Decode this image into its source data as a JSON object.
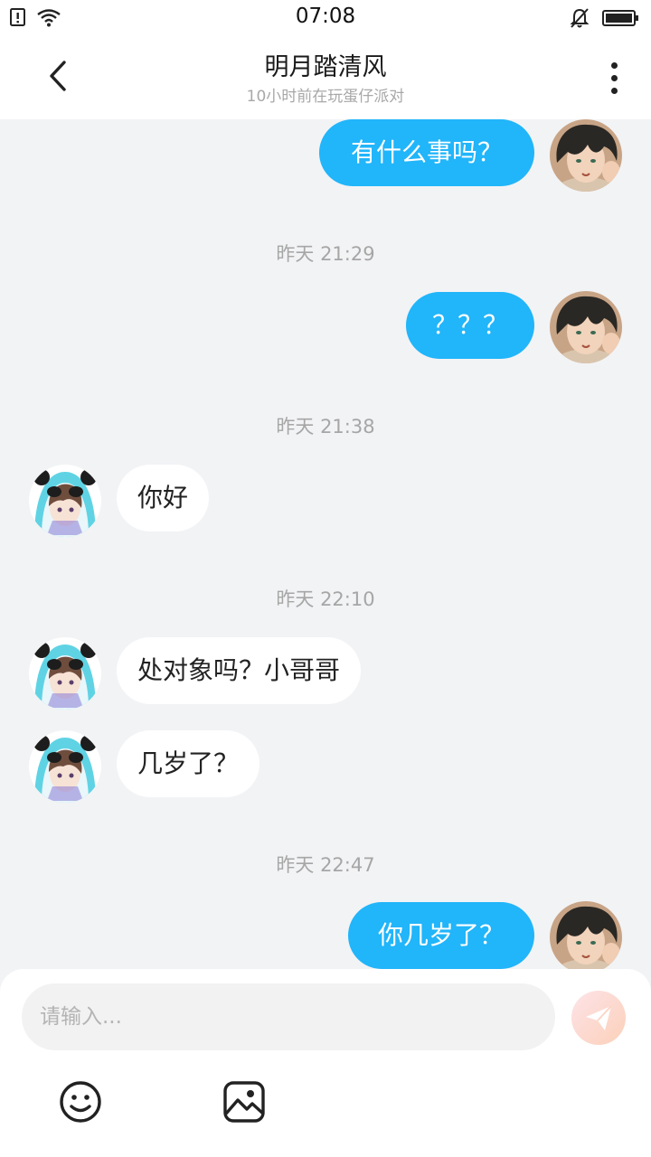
{
  "status_bar": {
    "time": "07:08",
    "left_icons": [
      "notification-alert-icon",
      "wifi-icon"
    ],
    "right_icons": [
      "bell-muted-icon",
      "battery-icon"
    ]
  },
  "header": {
    "title": "明月踏清风",
    "subtitle": "10小时前在玩蛋仔派对",
    "back_icon": "chevron-left-icon",
    "more_icon": "more-vertical-icon"
  },
  "messages": {
    "m1": {
      "sender": "me",
      "text": "有什么事吗？"
    },
    "t1": "昨天 21:29",
    "m2": {
      "sender": "me",
      "text": "？？？"
    },
    "t2": "昨天 21:38",
    "m3": {
      "sender": "other",
      "text": "你好"
    },
    "t3": "昨天 22:10",
    "m4": {
      "sender": "other",
      "text": "处对象吗？小哥哥"
    },
    "m5": {
      "sender": "other",
      "text": "几岁了？"
    },
    "t4": "昨天 22:47",
    "m6": {
      "sender": "me",
      "text": "你几岁了？"
    }
  },
  "composer": {
    "placeholder": "请输入...",
    "value": "",
    "send_icon": "paper-plane-icon",
    "emoji_icon": "smiley-icon",
    "image_icon": "image-icon"
  },
  "colors": {
    "outgoing_bubble": "#21b5fa",
    "incoming_bubble": "#ffffff",
    "chat_background": "#f2f3f5",
    "timestamp_text": "#a6a6a6"
  }
}
